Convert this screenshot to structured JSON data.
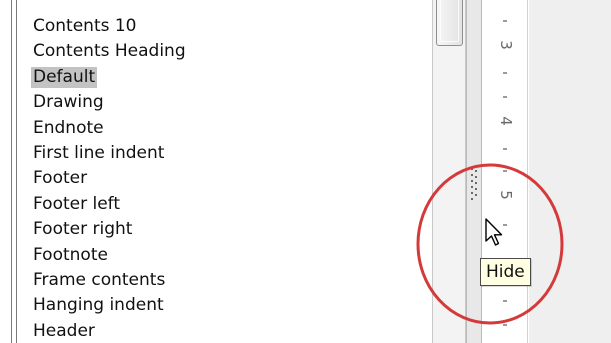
{
  "styles_panel": {
    "items": [
      {
        "label": "Contents 10"
      },
      {
        "label": "Contents Heading"
      },
      {
        "label": "Default",
        "selected": true
      },
      {
        "label": "Drawing"
      },
      {
        "label": "Endnote"
      },
      {
        "label": "First line indent"
      },
      {
        "label": "Footer"
      },
      {
        "label": "Footer left"
      },
      {
        "label": "Footer right"
      },
      {
        "label": "Footnote"
      },
      {
        "label": "Frame contents"
      },
      {
        "label": "Hanging indent"
      },
      {
        "label": "Header"
      }
    ]
  },
  "ruler": {
    "labels": [
      "3",
      "4",
      "5"
    ]
  },
  "tooltip": {
    "text": "Hide"
  },
  "icons": {
    "cursor": "arrow-pointer-icon",
    "grip": "splitter-grip-icon"
  },
  "colors": {
    "selection": "#c3c3c3",
    "highlight_ellipse": "#d43a3a",
    "tooltip_bg": "#ffffe1"
  }
}
